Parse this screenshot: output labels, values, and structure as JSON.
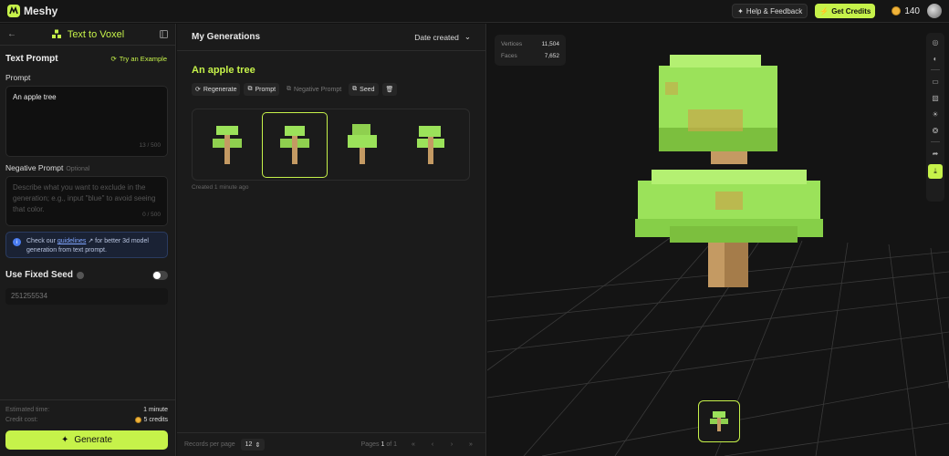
{
  "brand": {
    "name": "Meshy"
  },
  "topbar": {
    "help_label": "Help & Feedback",
    "credits_label": "Get Credits",
    "coins": "140"
  },
  "left": {
    "mode_title": "Text to Voxel",
    "section_title": "Text Prompt",
    "try_example": "Try an Example",
    "prompt_label": "Prompt",
    "prompt_value": "An apple tree",
    "prompt_count": "13 / 500",
    "neg_label": "Negative Prompt",
    "neg_optional": "Optional",
    "neg_placeholder": "Describe what you want to exclude in the generation; e.g., input \"blue\" to avoid seeing that color.",
    "neg_count": "0 / 500",
    "notice_pre": "Check our ",
    "notice_link": "guidelines",
    "notice_post": " for better 3d model generation from text prompt.",
    "seed_label": "Use Fixed Seed",
    "seed_value": "251255534",
    "est_time_label": "Estimated time:",
    "est_time_value": "1 minute",
    "credit_label": "Credit cost:",
    "credit_value": "5 credits",
    "generate_label": "Generate"
  },
  "middle": {
    "title": "My Generations",
    "sort_label": "Date created",
    "generation_title": "An apple tree",
    "actions": {
      "regenerate": "Regenerate",
      "prompt": "Prompt",
      "negative": "Negative Prompt",
      "seed": "Seed"
    },
    "created": "Created 1 minute ago",
    "records_label": "Records per page",
    "records_value": "12",
    "pages_prefix": "Pages",
    "page_current": "1",
    "page_of": "of 1"
  },
  "viewport": {
    "vertices_label": "Vertices",
    "vertices_value": "11,504",
    "faces_label": "Faces",
    "faces_value": "7,652"
  },
  "colors": {
    "accent": "#c6f24a",
    "leaf": "#9be25a",
    "trunk": "#c49a63"
  }
}
